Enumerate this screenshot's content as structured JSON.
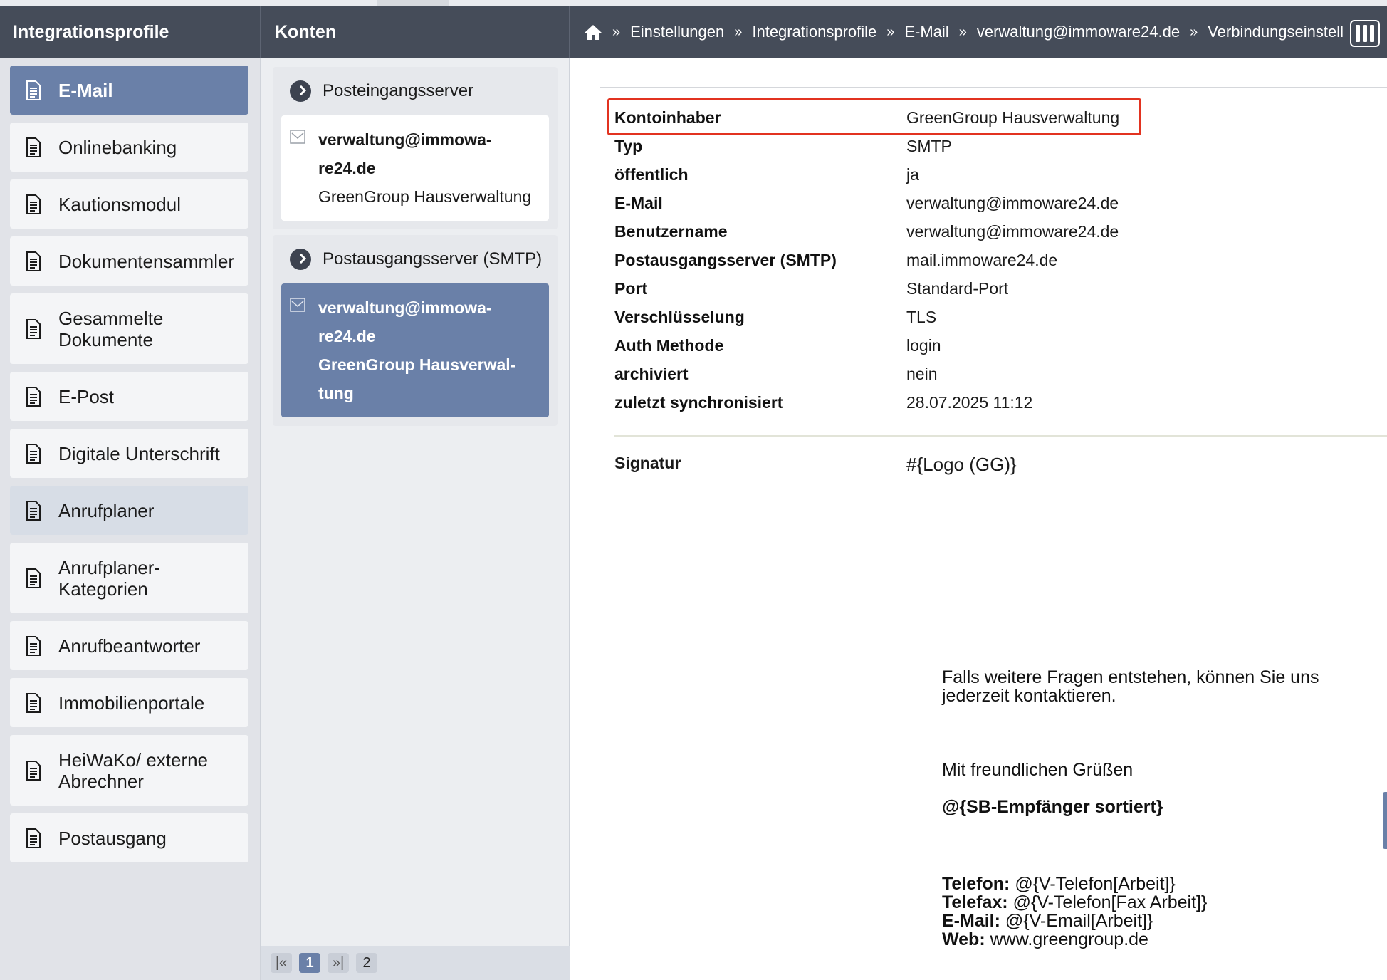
{
  "header": {
    "left_title": "Integrationsprofile",
    "mid_title": "Konten",
    "breadcrumb": {
      "sep": "»",
      "items": [
        "Einstellungen",
        "Integrationsprofile",
        "E-Mail",
        "verwaltung@immoware24.de",
        "Verbindungseinstell"
      ]
    }
  },
  "sidebar": {
    "items": [
      {
        "label": "E-Mail"
      },
      {
        "label": "Onlinebanking"
      },
      {
        "label": "Kautionsmodul"
      },
      {
        "label": "Dokumentensammler"
      },
      {
        "label": "Gesammelte Dokumente"
      },
      {
        "label": "E-Post"
      },
      {
        "label": "Digitale Unterschrift"
      },
      {
        "label": "Anrufplaner"
      },
      {
        "label": "Anrufplaner-Kategorien"
      },
      {
        "label": "Anrufbeantworter"
      },
      {
        "label": "Immobilienportale"
      },
      {
        "label": "HeiWaKo/ externe Abrechner"
      },
      {
        "label": "Postausgang"
      }
    ]
  },
  "accounts": {
    "incoming": {
      "title": "Posteingangsserver",
      "line1": "verwaltung@immowa-",
      "line2": "re24.de",
      "line3": "GreenGroup Hausverwaltung"
    },
    "outgoing": {
      "title": "Postausgangsserver (SMTP)",
      "line1": "verwaltung@immowa-",
      "line2": "re24.de",
      "line3": "GreenGroup Hausverwal-",
      "line4": "tung"
    },
    "pager": {
      "first": "|«",
      "current": "1",
      "last": "»|",
      "total": "2"
    }
  },
  "detail": {
    "rows": [
      {
        "key": "Kontoinhaber",
        "value": "GreenGroup Hausverwaltung"
      },
      {
        "key": "Typ",
        "value": "SMTP"
      },
      {
        "key": "öffentlich",
        "value": "ja"
      },
      {
        "key": "E-Mail",
        "value": "verwaltung@immoware24.de"
      },
      {
        "key": "Benutzername",
        "value": "verwaltung@immoware24.de"
      },
      {
        "key": "Postausgangsserver (SMTP)",
        "value": "mail.immoware24.de"
      },
      {
        "key": "Port",
        "value": "Standard-Port"
      },
      {
        "key": "Verschlüsselung",
        "value": "TLS"
      },
      {
        "key": "Auth Methode",
        "value": "login"
      },
      {
        "key": "archiviert",
        "value": "nein"
      },
      {
        "key": "zuletzt synchronisiert",
        "value": "28.07.2025 11:12"
      }
    ],
    "signature_label": "Signatur",
    "signature_value": "#{Logo (GG)}",
    "signature_body": {
      "p1": "Falls weitere Fragen entstehen, können Sie uns jederzeit kontaktieren.",
      "p2": "Mit freundlichen Grüßen",
      "p3": "@{SB-Empfänger sortiert}",
      "contact": [
        {
          "label": "Telefon:",
          "value": " @{V-Telefon[Arbeit]}"
        },
        {
          "label": "Telefax:",
          "value": " @{V-Telefon[Fax Arbeit]}"
        },
        {
          "label": "E-Mail:",
          "value": " @{V-Email[Arbeit]}"
        },
        {
          "label": "Web:",
          "value": " www.greengroup.de"
        }
      ]
    }
  },
  "colors": {
    "accent": "#6a80a8",
    "header": "#454c59",
    "highlight": "#e23320"
  }
}
